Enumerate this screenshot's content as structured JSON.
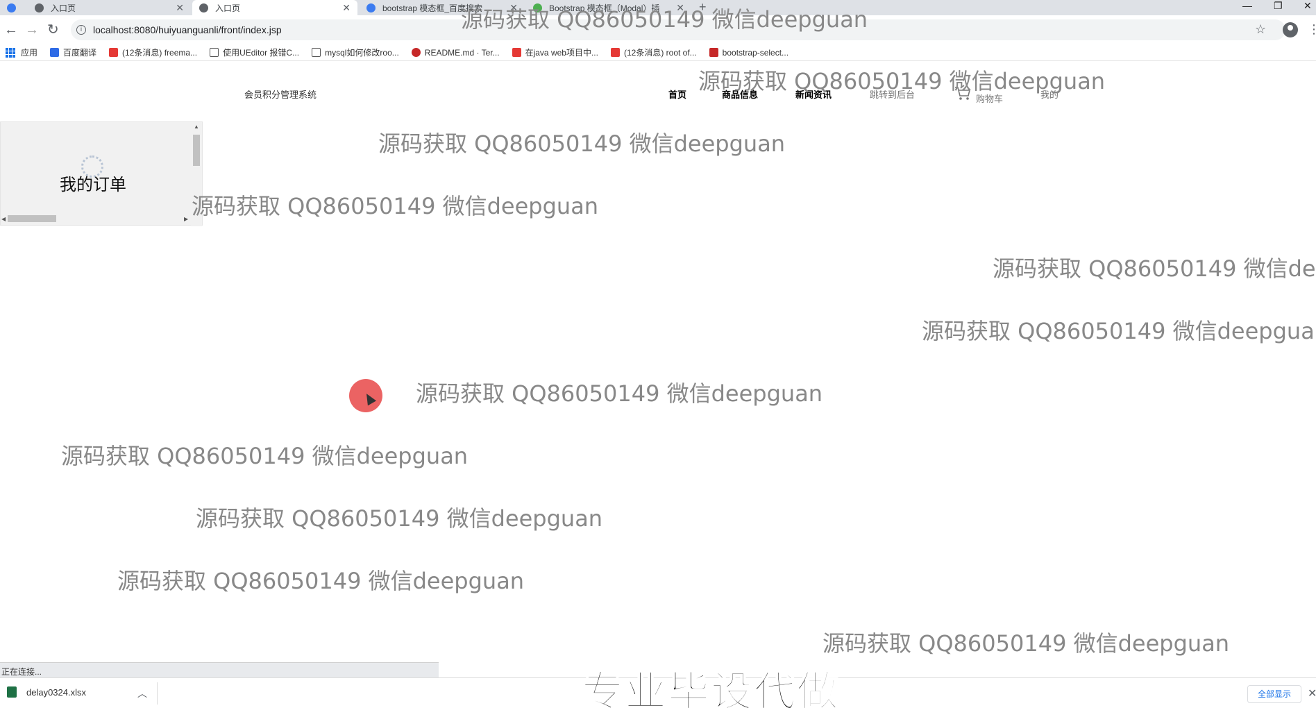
{
  "browser": {
    "tabs": [
      {
        "label": ""
      },
      {
        "label": "入口页"
      },
      {
        "label": "入口页"
      },
      {
        "label": "bootstrap 模态框_百度搜索"
      },
      {
        "label": "Bootstrap 模态框（Modal）插"
      }
    ],
    "address": "localhost:8080/huiyuanguanli/front/index.jsp",
    "bookmarks": [
      {
        "label": "应用",
        "color": "#1a73e8"
      },
      {
        "label": "百度翻译",
        "color": "#2e6be6"
      },
      {
        "label": "(12条消息) freema...",
        "color": "#e53935"
      },
      {
        "label": "使用UEditor 报错C...",
        "color": "#555555"
      },
      {
        "label": "mysql如何修改roo...",
        "color": "#555555"
      },
      {
        "label": "README.md · Ter...",
        "color": "#c62828"
      },
      {
        "label": "在java web项目中...",
        "color": "#e53935"
      },
      {
        "label": "(12条消息) root of...",
        "color": "#e53935"
      },
      {
        "label": "bootstrap-select...",
        "color": "#c62828"
      }
    ]
  },
  "site": {
    "title": "会员积分管理系统",
    "nav": {
      "home": "首页",
      "products": "商品信息",
      "news": "新闻资讯",
      "admin": "跳转到后台",
      "cart": "购物车",
      "mine": "我的"
    }
  },
  "side_frame": {
    "label": "我的订单"
  },
  "watermark_text": "源码获取 QQ86050149 微信deepguan",
  "status": "正在连接...",
  "downloads": {
    "file": "delay0324.xlsx",
    "show_all": "全部显示"
  },
  "caption": "专业毕设代做",
  "colors": {
    "tabstrip": "#dee1e6",
    "click_indicator": "#e84848",
    "watermark": "#888888"
  }
}
